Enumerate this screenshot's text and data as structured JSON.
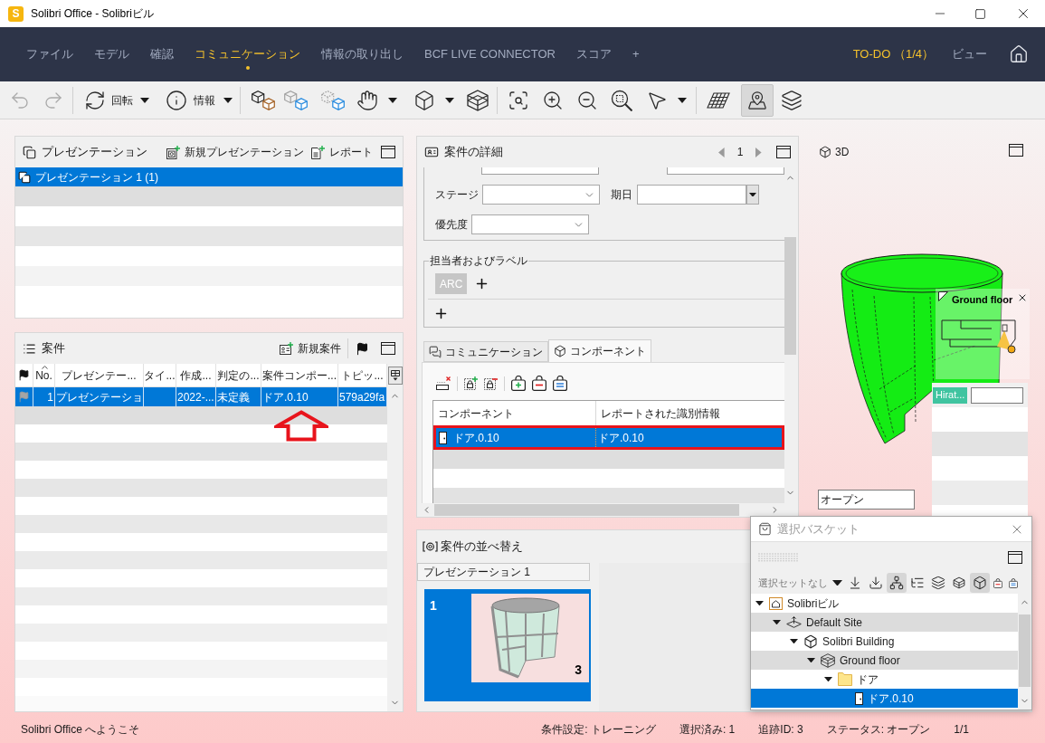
{
  "window": {
    "title": "Solibri Office - Solibriビル",
    "app_icon": "S"
  },
  "menu": {
    "items": [
      {
        "label": "ファイル",
        "selected": false
      },
      {
        "label": "モデル",
        "selected": false
      },
      {
        "label": "確認",
        "selected": false
      },
      {
        "label": "コミュニケーション",
        "selected": true
      },
      {
        "label": "情報の取り出し",
        "selected": false
      },
      {
        "label": "BCF LIVE CONNECTOR",
        "selected": false
      },
      {
        "label": "スコア",
        "selected": false
      },
      {
        "label": "+",
        "selected": false
      }
    ],
    "todo": "TO-DO （1/4）",
    "view": "ビュー"
  },
  "toolbar": {
    "undo": {
      "disabled": true
    },
    "redo": {
      "disabled": true
    },
    "rotate": {
      "label": "回転"
    },
    "info": {
      "label": "情報"
    },
    "map_view": {
      "selected": true
    }
  },
  "presentations": {
    "title": "プレゼンテーション",
    "new_button": "新規プレゼンテーション",
    "report_button": "レポート",
    "items": [
      {
        "label": "プレゼンテーション 1 (1)",
        "selected": true
      }
    ]
  },
  "issues": {
    "title": "案件",
    "new_button": "新規案件",
    "columns": [
      {
        "label": "No.",
        "sorted": true
      },
      {
        "label": "プレゼンテー...",
        "sorted": false
      },
      {
        "label": "タイ...",
        "sorted": false
      },
      {
        "label": "作成...",
        "sorted": false
      },
      {
        "label": "判定の...",
        "sorted": false
      },
      {
        "label": "案件コンポー...",
        "sorted": false
      },
      {
        "label": "トピッ...",
        "sorted": false
      }
    ],
    "rows": [
      {
        "selected": true,
        "no": "1",
        "presentation": "プレゼンテーショ",
        "created": "2022-...",
        "decision": "未定義",
        "component": "ドア.0.10",
        "topic": "579a29fa"
      }
    ]
  },
  "details": {
    "title": "案件の詳細",
    "page": "1",
    "fields": [
      {
        "kind": "select",
        "label": "ステージ"
      },
      {
        "kind": "date",
        "label": "期日"
      },
      {
        "kind": "select",
        "label": "優先度"
      }
    ],
    "assignees": {
      "title": "担当者およびラベル",
      "tags": [
        "ARC"
      ]
    },
    "tabs": [
      {
        "kind": "communication",
        "label": "コミュニケーション",
        "selected": false
      },
      {
        "kind": "component",
        "label": "コンポーネント",
        "selected": true
      }
    ],
    "components": {
      "columns": [
        "コンポーネント",
        "レポートされた識別情報"
      ],
      "rows": [
        {
          "component": "ドア.0.10",
          "identifier": "ドア.0.10",
          "selected": true,
          "highlighted": true
        }
      ]
    }
  },
  "sorting": {
    "title": "案件の並べ替え",
    "group": "プレゼンテーション 1",
    "slides": [
      {
        "number": "1",
        "tracking_id": "3",
        "selected": true
      }
    ]
  },
  "view3d": {
    "title": "3D",
    "floor_popup": {
      "title": "Ground floor"
    },
    "tag": "Hirat...",
    "status_field": "オープン"
  },
  "basket": {
    "title": "選択バスケット",
    "selection_set": "選択セットなし",
    "tools": [
      {
        "kind": "download",
        "selected": false
      },
      {
        "kind": "import",
        "selected": false
      },
      {
        "kind": "hierarchy",
        "selected": true
      },
      {
        "kind": "tree",
        "selected": false
      },
      {
        "kind": "layers",
        "selected": false
      },
      {
        "kind": "storey",
        "selected": false
      },
      {
        "kind": "model",
        "selected": true
      },
      {
        "kind": "remove",
        "selected": false
      },
      {
        "kind": "show",
        "selected": false
      }
    ],
    "tree": [
      {
        "label": "Solibriビル",
        "kind": "project",
        "expanded": true,
        "selected": false,
        "children": [
          {
            "label": "Default Site",
            "kind": "site",
            "expanded": true,
            "selected": false,
            "children": [
              {
                "label": "Solibri Building",
                "kind": "building",
                "expanded": true,
                "selected": false,
                "children": [
                  {
                    "label": "Ground floor",
                    "kind": "storey",
                    "expanded": true,
                    "selected": false,
                    "children": [
                      {
                        "label": "ドア",
                        "kind": "folder",
                        "expanded": true,
                        "selected": false,
                        "children": [
                          {
                            "label": "ドア.0.10",
                            "kind": "door",
                            "selected": true
                          }
                        ]
                      }
                    ]
                  }
                ]
              }
            ]
          }
        ]
      }
    ]
  },
  "status_bar": {
    "message": "Solibri Office へようこそ",
    "items": [
      "条件設定: トレーニング",
      "選択済み: 1",
      "追跡ID: 3",
      "ステータス: オープン",
      "1/1"
    ]
  }
}
